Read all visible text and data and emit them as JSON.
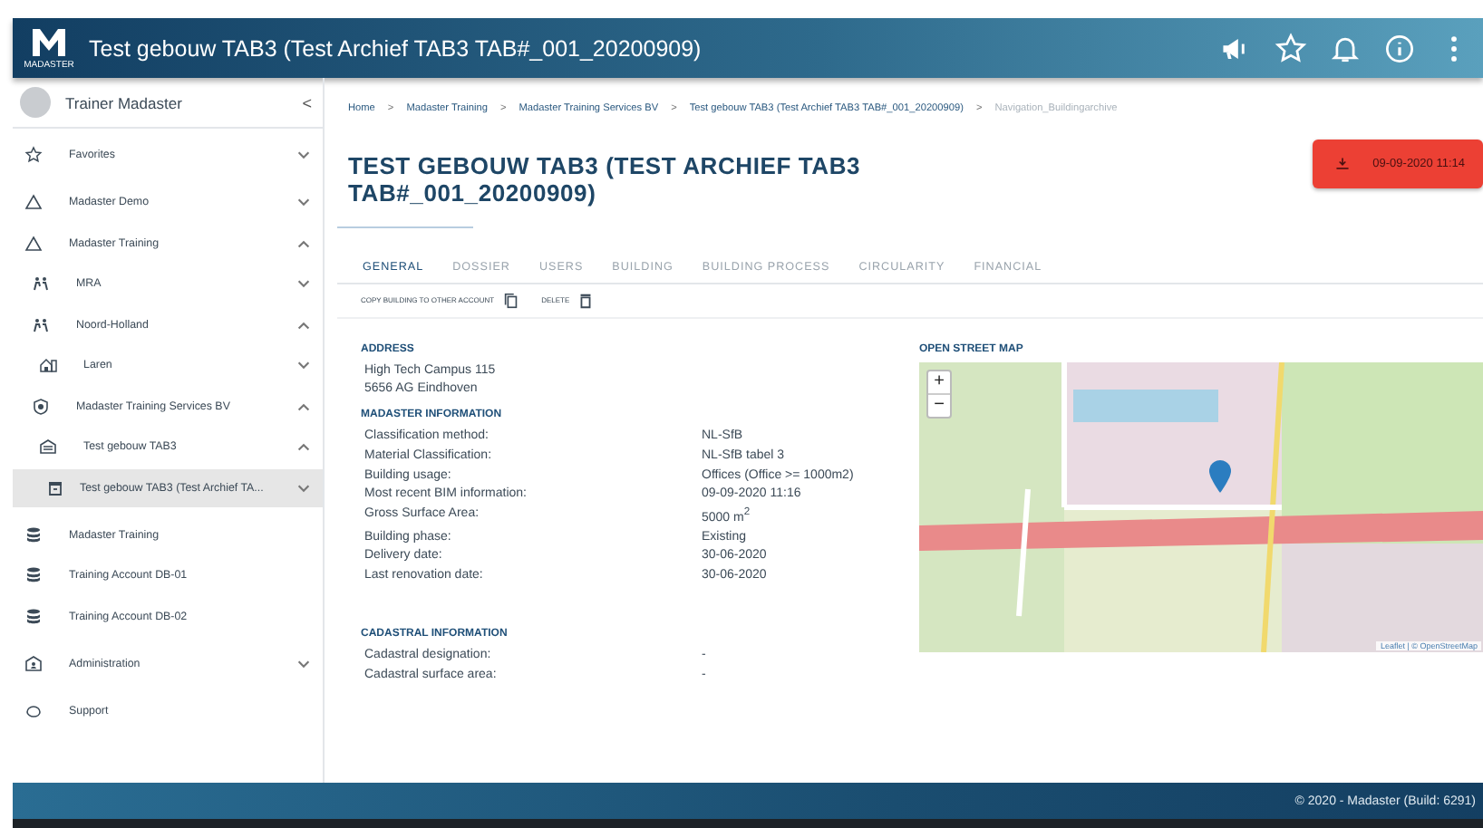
{
  "header": {
    "title": "Test gebouw TAB3 (Test Archief TAB3 TAB#_001_20200909)",
    "logo_caption": "MADASTER",
    "icons": [
      {
        "kind": "megaphone"
      },
      {
        "kind": "star"
      },
      {
        "kind": "bell"
      },
      {
        "kind": "info"
      },
      {
        "kind": "more"
      }
    ]
  },
  "sidebar": {
    "user": "Trainer Madaster",
    "collapse": "<",
    "items": [
      {
        "kind": "star",
        "label": "Favorites",
        "expanded": false,
        "selected": false
      },
      {
        "kind": "triangle",
        "label": "Madaster Demo",
        "expanded": false,
        "selected": false
      },
      {
        "kind": "triangle",
        "label": "Madaster Training",
        "expanded": true,
        "selected": false,
        "children": [
          {
            "kind": "people",
            "label": "MRA",
            "expanded": false,
            "selected": false
          },
          {
            "kind": "people",
            "label": "Noord-Holland",
            "expanded": true,
            "selected": false,
            "children": [
              {
                "kind": "house",
                "label": "Laren",
                "expanded": false,
                "selected": false
              }
            ]
          },
          {
            "kind": "badge",
            "label": "Madaster Training Services BV",
            "expanded": true,
            "selected": false,
            "children": [
              {
                "kind": "building",
                "label": "Test gebouw TAB3",
                "expanded": true,
                "selected": false,
                "children": [
                  {
                    "kind": "archive",
                    "label": "Test gebouw TAB3 (Test Archief TA...",
                    "expanded": false,
                    "selected": true
                  }
                ]
              }
            ]
          }
        ]
      },
      {
        "kind": "database",
        "label": "Madaster Training",
        "selected": false
      },
      {
        "kind": "database",
        "label": "Training Account DB-01",
        "selected": false
      },
      {
        "kind": "database",
        "label": "Training Account DB-02",
        "selected": false
      },
      {
        "kind": "admin",
        "label": "Administration",
        "expanded": false,
        "selected": false
      },
      {
        "kind": "support",
        "label": "Support",
        "selected": false
      }
    ]
  },
  "breadcrumb": [
    {
      "label": "Home",
      "current": false
    },
    {
      "label": "Madaster Training",
      "current": false
    },
    {
      "label": "Madaster Training Services BV",
      "current": false
    },
    {
      "label": "Test gebouw TAB3 (Test Archief TAB3 TAB#_001_20200909)",
      "current": false
    },
    {
      "label": "Navigation_Buildingarchive",
      "current": true
    }
  ],
  "breadcrumb_separator": ">",
  "page_title": "TEST GEBOUW TAB3 (TEST ARCHIEF TAB3 TAB#_001_20200909)",
  "archive_button": {
    "label": "09-09-2020 11:14"
  },
  "tabs": [
    {
      "label": "GENERAL",
      "selected": true
    },
    {
      "label": "DOSSIER",
      "selected": false
    },
    {
      "label": "USERS",
      "selected": false
    },
    {
      "label": "BUILDING",
      "selected": false
    },
    {
      "label": "BUILDING PROCESS",
      "selected": false
    },
    {
      "label": "CIRCULARITY",
      "selected": false
    },
    {
      "label": "FINANCIAL",
      "selected": false
    }
  ],
  "actions": [
    {
      "kind": "copy",
      "label": "COPY BUILDING TO OTHER ACCOUNT"
    },
    {
      "kind": "delete",
      "label": "DELETE"
    }
  ],
  "address": {
    "heading": "ADDRESS",
    "lines": [
      "High Tech Campus 115",
      "5656 AG Eindhoven"
    ]
  },
  "madaster_information": {
    "heading": "MADASTER INFORMATION",
    "rows": [
      {
        "label": "Classification method:",
        "value": "NL-SfB"
      },
      {
        "label": "Material Classification:",
        "value": "NL-SfB tabel 3"
      },
      {
        "label": "Building usage:",
        "value": "Offices (Office >= 1000m2)"
      },
      {
        "label": "Most recent BIM information:",
        "value": "09-09-2020 11:16"
      },
      {
        "label": "Gross Surface Area:",
        "value": "5000 m$^{2}$"
      },
      {
        "label": "Building phase:",
        "value": "Existing"
      },
      {
        "label": "Delivery date:",
        "value": "30-06-2020"
      },
      {
        "label": "Last renovation date:",
        "value": "30-06-2020"
      }
    ]
  },
  "cadastral_information": {
    "heading": "CADASTRAL INFORMATION",
    "rows": [
      {
        "label": "Cadastral designation:",
        "value": "-"
      },
      {
        "label": "Cadastral surface area:",
        "value": "-"
      }
    ]
  },
  "map": {
    "heading": "OPEN STREET MAP",
    "zoom_in": "+",
    "zoom_out": "−",
    "attribution": "Leaflet | © OpenStreetMap"
  },
  "footer": {
    "text": "© 2020 - Madaster (Build: 6291)"
  }
}
